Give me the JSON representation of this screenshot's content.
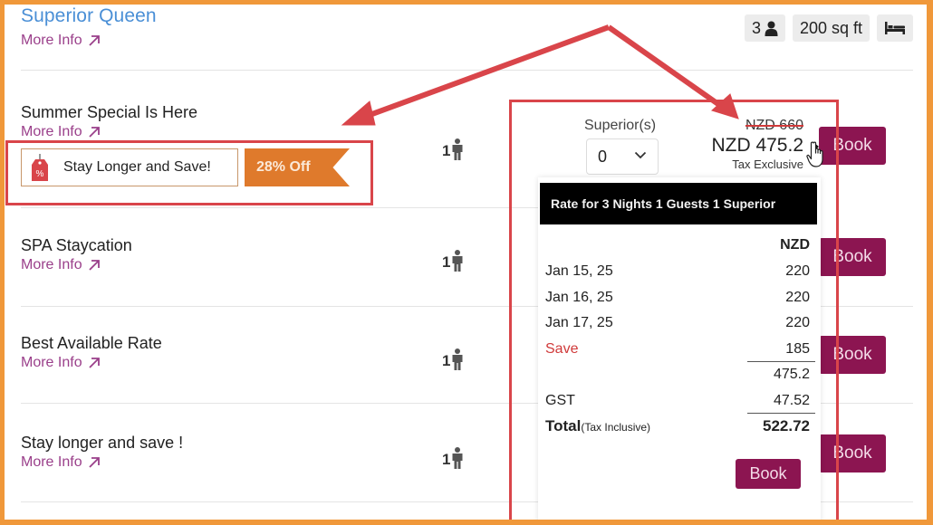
{
  "room": {
    "title": "Superior Queen",
    "more_info": "More Info",
    "badges": {
      "guests": "3",
      "guests_icon": "person-icon",
      "size": "200 sq ft",
      "bed_icon": "bed-icon"
    }
  },
  "rates": [
    {
      "name": "Summer Special Is Here",
      "more_info": "More Info",
      "occupancy": "1",
      "book_label": "Book"
    },
    {
      "name": "SPA Staycation",
      "more_info": "More Info",
      "occupancy": "1",
      "book_label": "Book"
    },
    {
      "name": "Best Available Rate",
      "more_info": "More Info",
      "occupancy": "1",
      "book_label": "Book"
    },
    {
      "name": "Stay longer and save !",
      "more_info": "More Info",
      "occupancy": "1",
      "book_label": "Book"
    }
  ],
  "promo": {
    "tag_icon": "discount-tag-icon",
    "label": "Stay Longer and Save!",
    "discount": "28% Off"
  },
  "room_selector": {
    "label": "Superior(s)",
    "value": "0"
  },
  "price": {
    "original": "NZD 660",
    "discounted": "NZD 475.2",
    "tax_note": "Tax Exclusive"
  },
  "breakdown": {
    "title": "Rate for 3 Nights 1 Guests 1 Superior",
    "currency": "NZD",
    "nights": [
      {
        "date": "Jan 15, 25",
        "amount": "220"
      },
      {
        "date": "Jan 16, 25",
        "amount": "220"
      },
      {
        "date": "Jan 17, 25",
        "amount": "220"
      }
    ],
    "save_label": "Save",
    "save_amount": "185",
    "subtotal": "475.2",
    "tax_label": "GST",
    "tax_amount": "47.52",
    "total_label": "Total",
    "total_note": "(Tax Inclusive)",
    "total_amount": "522.72",
    "book_label": "Book"
  },
  "colors": {
    "frame": "#f0983a",
    "annotation": "#d9454a",
    "book_button": "#8c1551",
    "room_title": "#4a8fd6",
    "more_info_link": "#9a3f8a",
    "promo_ribbon": "#df7a2c",
    "save_text": "#d03a3a"
  }
}
